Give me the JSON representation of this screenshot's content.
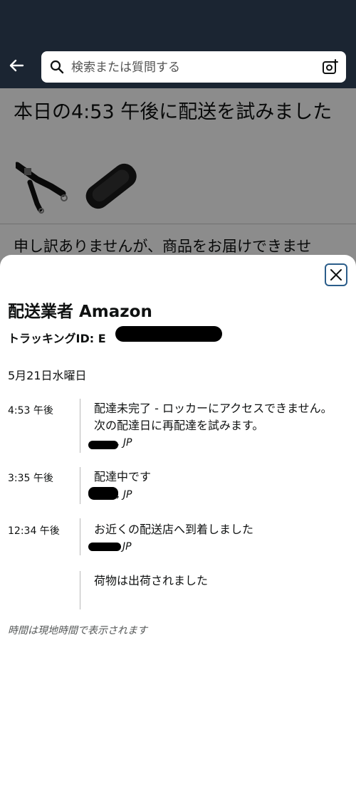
{
  "search": {
    "placeholder": "検索または質問する"
  },
  "background_page": {
    "title": "本日の4:53 午後に配送を試みました",
    "message": "申し訳ありませんが、商品をお届けできませ"
  },
  "sheet": {
    "carrier_title": "配送業者 Amazon",
    "tracking_label": "トラッキングID: E",
    "date_heading": "5月21日水曜日",
    "events": [
      {
        "time": "4:53 午後",
        "text": "配達未完了 - ロッカーにアクセスできません。次の配達日に再配達を試みます。",
        "location": ", JP"
      },
      {
        "time": "3:35 午後",
        "text": "配達中です",
        "location": ", JP"
      },
      {
        "time": "12:34 午後",
        "text": "お近くの配送店へ到着しました",
        "location": "JP"
      },
      {
        "time": "",
        "text": "荷物は出荷されました",
        "location": ""
      }
    ],
    "footnote": "時間は現地時間で表示されます"
  },
  "colors": {
    "header_bg": "#1b2532",
    "close_border": "#2b5d8a",
    "overlay": "rgba(0,0,0,0.45)"
  },
  "icons": {
    "back": "arrow-left-icon",
    "search": "search-icon",
    "camera": "camera-plus-icon",
    "close": "close-icon"
  }
}
